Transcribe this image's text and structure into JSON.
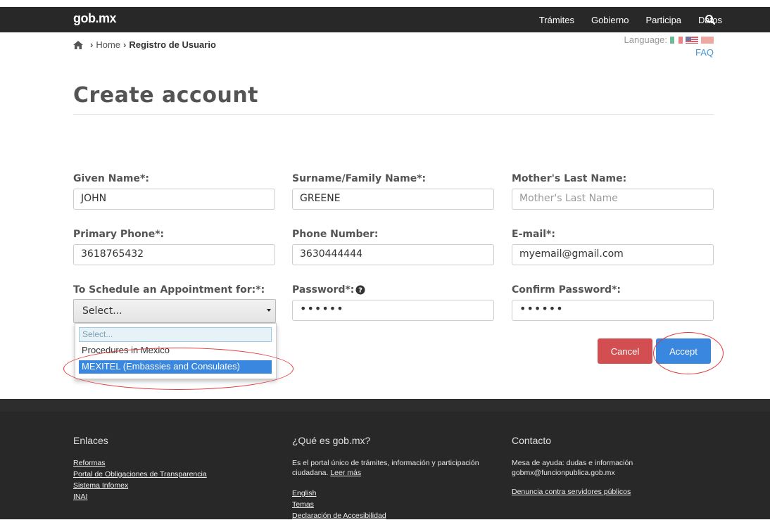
{
  "header": {
    "logo": "gob.mx",
    "nav": [
      "Trámites",
      "Gobierno",
      "Participa",
      "Datos"
    ]
  },
  "breadcrumb": {
    "home": "Home",
    "current": "Registro de Usuario"
  },
  "language": {
    "label": "Language:"
  },
  "faq": "FAQ",
  "page_title": "Create account",
  "form": {
    "given_name": {
      "label": "Given Name*:",
      "value": "JOHN"
    },
    "surname": {
      "label": "Surname/Family Name*:",
      "value": "GREENE"
    },
    "mothers_last_name": {
      "label": "Mother's Last Name:",
      "placeholder": "Mother's Last Name"
    },
    "primary_phone": {
      "label": "Primary Phone*:",
      "value": "3618765432"
    },
    "phone_number": {
      "label": "Phone Number:",
      "value": "3630444444"
    },
    "email": {
      "label": "E-mail*:",
      "value": "myemail@gmail.com"
    },
    "schedule": {
      "label": "To Schedule an Appointment for:*:",
      "value": "Select...",
      "search_placeholder": "Select...",
      "options": [
        "Procedures in Mexico",
        "MEXITEL (Embassies and Consulates)"
      ],
      "highlighted": "MEXITEL (Embassies and Consulates)"
    },
    "password": {
      "label": "Password*:",
      "value": "••••••"
    },
    "confirm_password": {
      "label": "Confirm Password*:",
      "value": "••••••"
    },
    "cancel": "Cancel",
    "accept": "Accept"
  },
  "footer": {
    "enlaces": {
      "title": "Enlaces",
      "links": [
        "Reformas",
        "Portal de Obligaciones de Transparencia",
        "Sistema Infomex",
        "INAI"
      ]
    },
    "que_es": {
      "title": "¿Qué es gob.mx?",
      "text": "Es el portal único de trámites, información y participación ciudadana.",
      "more": "Leer más",
      "links": [
        "English",
        "Temas",
        "Declaración de Accesibilidad"
      ]
    },
    "contacto": {
      "title": "Contacto",
      "line1": "Mesa de ayuda: dudas e información",
      "line2": "gobmx@funcionpublica.gob.mx",
      "link": "Denuncia contra servidores públicos"
    }
  },
  "colors": {
    "navbar": "#282828",
    "accept": "#3a87df",
    "cancel": "#d24e50",
    "annotation": "#e5383b"
  }
}
